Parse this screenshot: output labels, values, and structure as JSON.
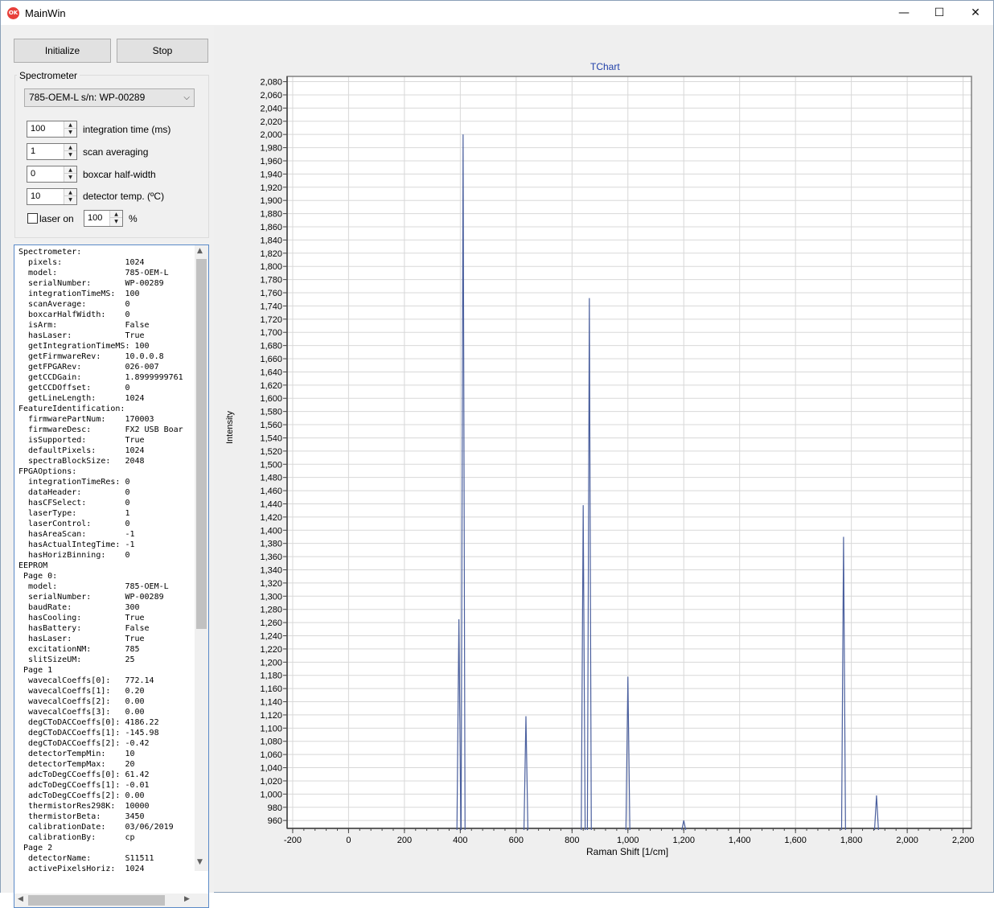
{
  "window": {
    "title": "MainWin",
    "icon_label": "OK",
    "controls": {
      "minimize": "—",
      "maximize": "☐",
      "close": "✕"
    }
  },
  "toolbar": {
    "initialize_label": "Initialize",
    "stop_label": "Stop"
  },
  "spectrometer_group": {
    "label": "Spectrometer",
    "device": "785-OEM-L  s/n: WP-00289",
    "integration_time": "100",
    "integration_time_label": "integration time (ms)",
    "scan_averaging": "1",
    "scan_averaging_label": "scan averaging",
    "boxcar": "0",
    "boxcar_label": "boxcar half-width",
    "detector_temp": "10",
    "detector_temp_label": "detector temp. (ºC)",
    "laser_label": "laser on",
    "laser_checked": false,
    "laser_power": "100",
    "laser_power_unit": "%"
  },
  "info_lines": [
    "Spectrometer:",
    "  pixels:             1024",
    "  model:              785-OEM-L",
    "  serialNumber:       WP-00289",
    "  integrationTimeMS:  100",
    "  scanAverage:        0",
    "  boxcarHalfWidth:    0",
    "  isArm:              False",
    "  hasLaser:           True",
    "  getIntegrationTimeMS: 100",
    "  getFirmwareRev:     10.0.0.8",
    "  getFPGARev:         026-007",
    "  getCCDGain:         1.8999999761",
    "  getCCDOffset:       0",
    "  getLineLength:      1024",
    "FeatureIdentification:",
    "  firmwarePartNum:    170003",
    "  firmwareDesc:       FX2 USB Boar",
    "  isSupported:        True",
    "  defaultPixels:      1024",
    "  spectraBlockSize:   2048",
    "FPGAOptions:",
    "  integrationTimeRes: 0",
    "  dataHeader:         0",
    "  hasCFSelect:        0",
    "  laserType:          1",
    "  laserControl:       0",
    "  hasAreaScan:        -1",
    "  hasActualIntegTime: -1",
    "  hasHorizBinning:    0",
    "EEPROM",
    " Page 0:",
    "  model:              785-OEM-L",
    "  serialNumber:       WP-00289",
    "  baudRate:           300",
    "  hasCooling:         True",
    "  hasBattery:         False",
    "  hasLaser:           True",
    "  excitationNM:       785",
    "  slitSizeUM:         25",
    " Page 1",
    "  wavecalCoeffs[0]:   772.14",
    "  wavecalCoeffs[1]:   0.20",
    "  wavecalCoeffs[2]:   0.00",
    "  wavecalCoeffs[3]:   0.00",
    "  degCToDACCoeffs[0]: 4186.22",
    "  degCToDACCoeffs[1]: -145.98",
    "  degCToDACCoeffs[2]: -0.42",
    "  detectorTempMin:    10",
    "  detectorTempMax:    20",
    "  adcToDegCCoeffs[0]: 61.42",
    "  adcToDegCCoeffs[1]: -0.01",
    "  adcToDegCCoeffs[2]: 0.00",
    "  thermistorRes298K:  10000",
    "  thermistorBeta:     3450",
    "  calibrationDate:    03/06/2019",
    "  calibrationBy:      cp",
    " Page 2",
    "  detectorName:       S11511",
    "  activePixelsHoriz:  1024"
  ],
  "chart_data": {
    "type": "line",
    "title": "TChart",
    "xlabel": "Raman Shift [1/cm]",
    "ylabel": "Intensity",
    "xlim": [
      -220,
      2230
    ],
    "ylim": [
      948,
      2088
    ],
    "grid": true,
    "xticks": [
      -200,
      0,
      200,
      400,
      600,
      800,
      1000,
      1200,
      1400,
      1600,
      1800,
      2000,
      2200
    ],
    "xtick_labels": [
      "-200",
      "0",
      "200",
      "400",
      "600",
      "800",
      "1,000",
      "1,200",
      "1,400",
      "1,600",
      "1,800",
      "2,000",
      "2,200"
    ],
    "yticks": [
      960,
      980,
      1000,
      1020,
      1040,
      1060,
      1080,
      1100,
      1120,
      1140,
      1160,
      1180,
      1200,
      1220,
      1240,
      1260,
      1280,
      1300,
      1320,
      1340,
      1360,
      1380,
      1400,
      1420,
      1440,
      1460,
      1480,
      1500,
      1520,
      1540,
      1560,
      1580,
      1600,
      1620,
      1640,
      1660,
      1680,
      1700,
      1720,
      1740,
      1760,
      1780,
      1800,
      1820,
      1840,
      1860,
      1880,
      1900,
      1920,
      1940,
      1960,
      1980,
      2000,
      2020,
      2040,
      2060,
      2080
    ],
    "ytick_labels": [
      "960",
      "980",
      "1,000",
      "1,020",
      "1,040",
      "1,060",
      "1,080",
      "1,100",
      "1,120",
      "1,140",
      "1,160",
      "1,180",
      "1,200",
      "1,220",
      "1,240",
      "1,260",
      "1,280",
      "1,300",
      "1,320",
      "1,340",
      "1,360",
      "1,380",
      "1,400",
      "1,420",
      "1,440",
      "1,460",
      "1,480",
      "1,500",
      "1,520",
      "1,540",
      "1,560",
      "1,580",
      "1,600",
      "1,620",
      "1,640",
      "1,660",
      "1,680",
      "1,700",
      "1,720",
      "1,740",
      "1,760",
      "1,780",
      "1,800",
      "1,820",
      "1,840",
      "1,860",
      "1,880",
      "1,900",
      "1,920",
      "1,940",
      "1,960",
      "1,980",
      "2,000",
      "2,020",
      "2,040",
      "2,060",
      "2,080"
    ],
    "series": [
      {
        "color": "#4a5f9e",
        "peaks": [
          {
            "x": 395,
            "y": 1265
          },
          {
            "x": 410,
            "y": 2000
          },
          {
            "x": 635,
            "y": 1118
          },
          {
            "x": 840,
            "y": 1438
          },
          {
            "x": 862,
            "y": 1752
          },
          {
            "x": 1000,
            "y": 1178
          },
          {
            "x": 1200,
            "y": 960
          },
          {
            "x": 1772,
            "y": 1390
          },
          {
            "x": 1890,
            "y": 998
          }
        ]
      }
    ]
  }
}
